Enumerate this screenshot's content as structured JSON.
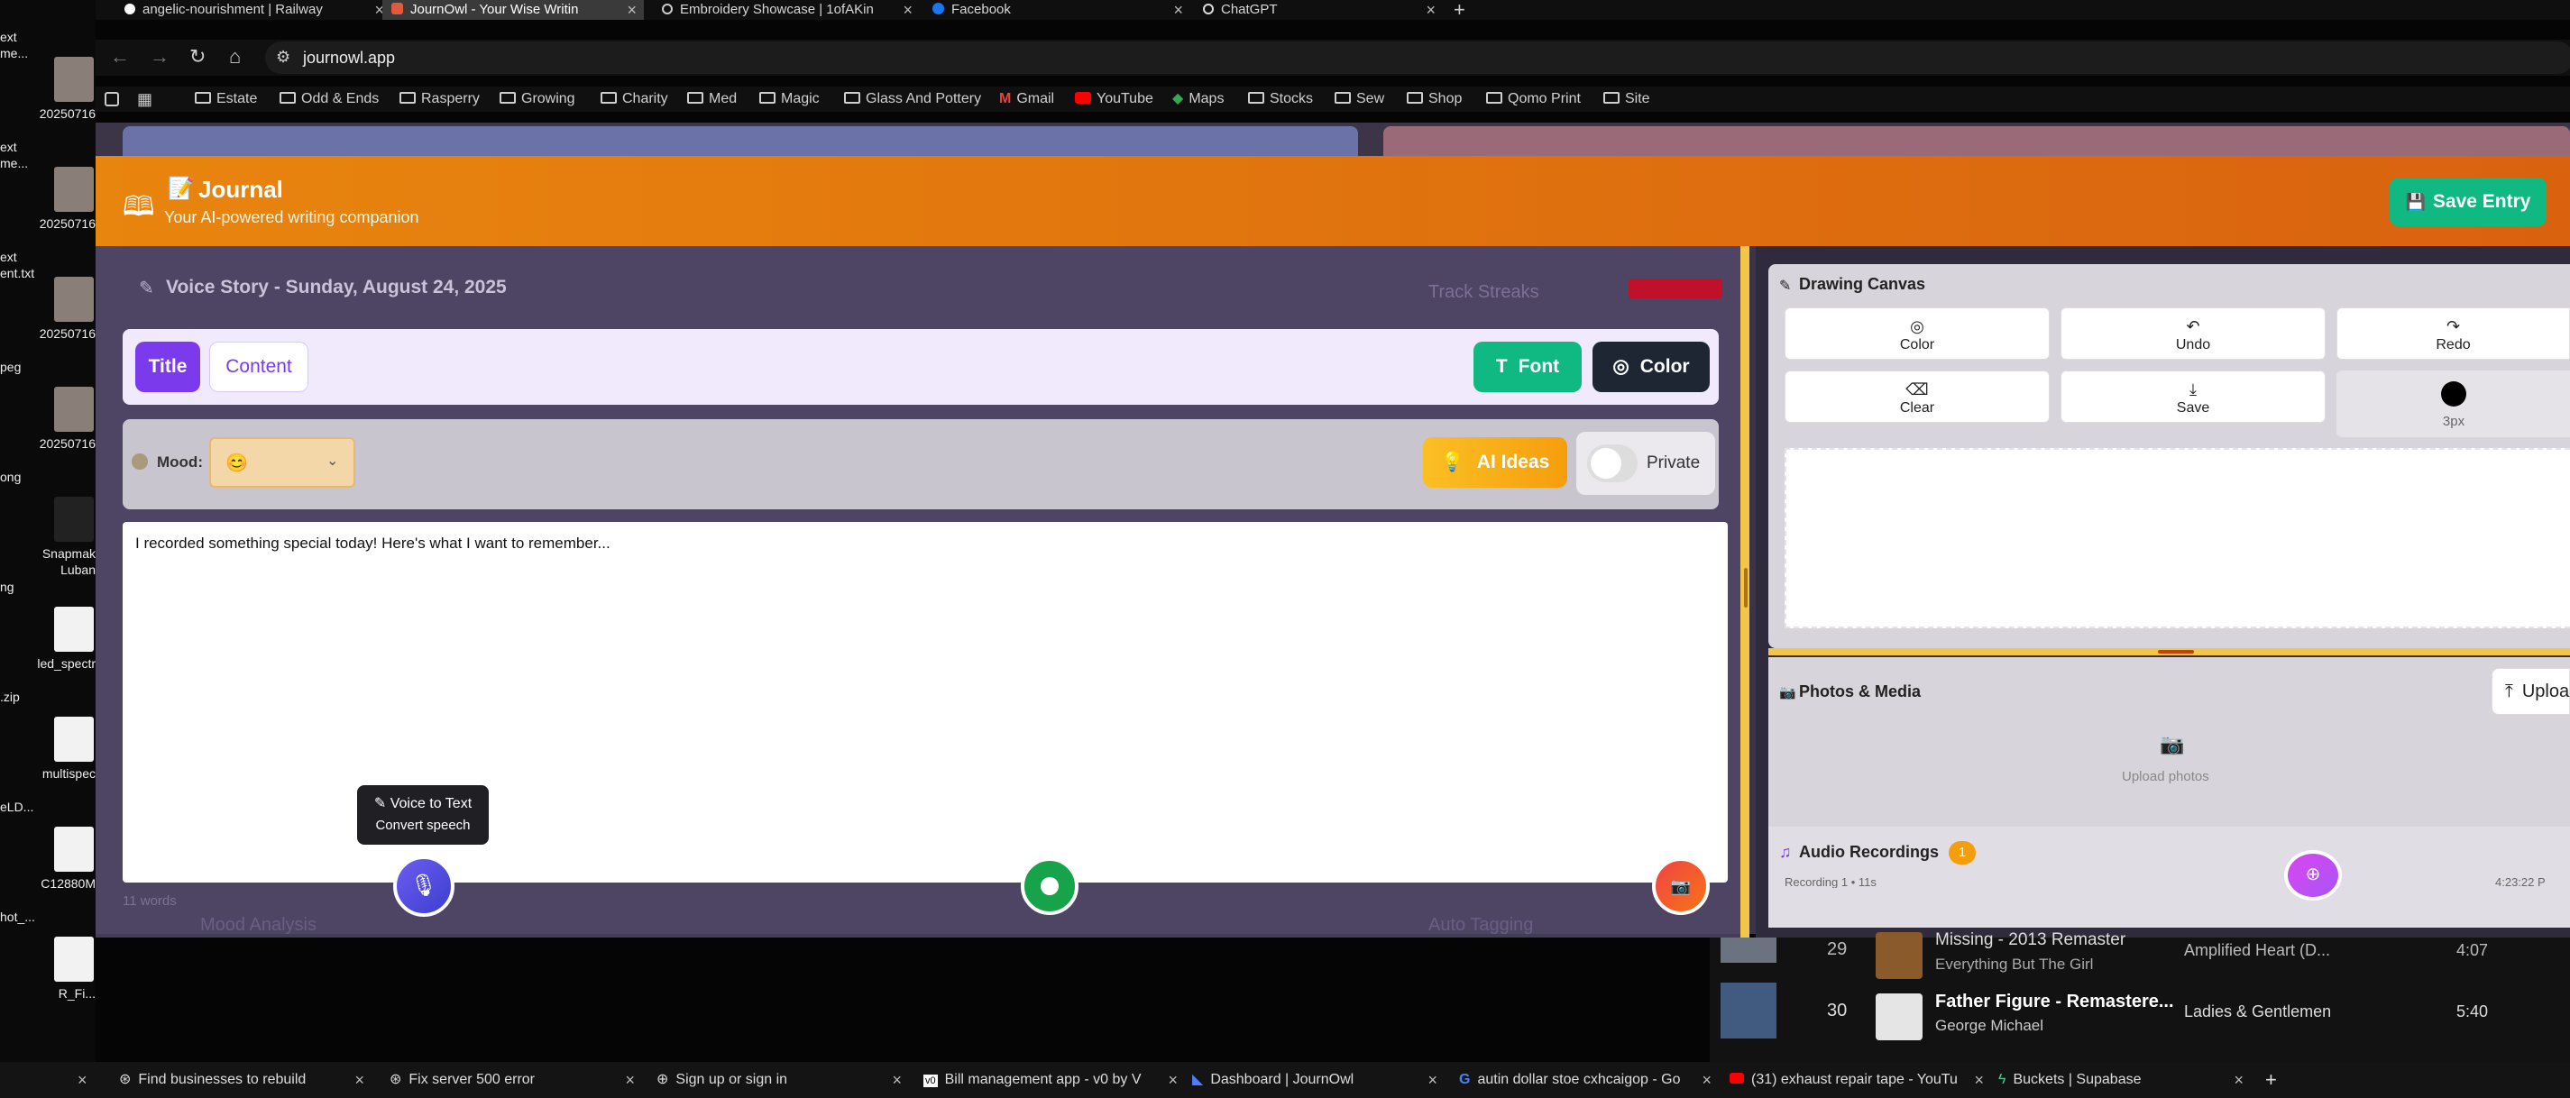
{
  "desktop": {
    "items": [
      {
        "label": "ext\nme...",
        "kind": "doc"
      },
      {
        "label": "20250716",
        "kind": "photo"
      },
      {
        "label": "ext\nme...",
        "kind": "doc"
      },
      {
        "label": "20250716",
        "kind": "photo"
      },
      {
        "label": "ext\nent.txt",
        "kind": "doc"
      },
      {
        "label": "20250716",
        "kind": "photo"
      },
      {
        "label": "peg",
        "kind": "photo"
      },
      {
        "label": "20250716",
        "kind": "photo"
      },
      {
        "label": "ong",
        "kind": "photo"
      },
      {
        "label": "Snapmak\nLuban",
        "kind": "app"
      },
      {
        "label": "ng",
        "kind": "photo"
      },
      {
        "label": "led_spectr",
        "kind": "doc"
      },
      {
        "label": ".zip",
        "kind": "zip"
      },
      {
        "label": "multispec",
        "kind": "doc"
      },
      {
        "label": "eLD...",
        "kind": "doc"
      },
      {
        "label": "C12880M",
        "kind": "doc"
      },
      {
        "label": "hot_...",
        "kind": "doc"
      },
      {
        "label": "R_Fi...",
        "kind": "doc"
      }
    ]
  },
  "browser": {
    "tabs": [
      {
        "label": "angelic-nourishment | Railway",
        "active": false,
        "icon": "railway-icon"
      },
      {
        "label": "JournOwl - Your Wise Writin",
        "active": true,
        "icon": "journowl-icon"
      },
      {
        "label": "Embroidery Showcase | 1ofAKin",
        "active": false,
        "icon": "globe-icon"
      },
      {
        "label": "Facebook",
        "active": false,
        "icon": "facebook-icon"
      },
      {
        "label": "ChatGPT",
        "active": false,
        "icon": "chatgpt-icon"
      }
    ],
    "new_tab": "+",
    "url": "journowl.app",
    "bookmarks": [
      {
        "label": "Estate",
        "icon": "folder-icon"
      },
      {
        "label": "Odd & Ends",
        "icon": "folder-icon"
      },
      {
        "label": "Rasperry",
        "icon": "folder-icon"
      },
      {
        "label": "Growing",
        "icon": "folder-icon"
      },
      {
        "label": "Charity",
        "icon": "folder-icon"
      },
      {
        "label": "Med",
        "icon": "folder-icon"
      },
      {
        "label": "Magic",
        "icon": "folder-icon"
      },
      {
        "label": "Glass And Pottery",
        "icon": "folder-icon"
      },
      {
        "label": "Gmail",
        "icon": "gmail-icon"
      },
      {
        "label": "YouTube",
        "icon": "youtube-icon"
      },
      {
        "label": "Maps",
        "icon": "maps-icon"
      },
      {
        "label": "Stocks",
        "icon": "folder-icon"
      },
      {
        "label": "Sew",
        "icon": "folder-icon"
      },
      {
        "label": "Shop",
        "icon": "folder-icon"
      },
      {
        "label": "Qomo Print",
        "icon": "folder-icon"
      },
      {
        "label": "Site",
        "icon": "folder-icon"
      }
    ]
  },
  "journal": {
    "title": "Journal",
    "subtitle": "Your AI-powered writing companion",
    "save_entry": "Save Entry",
    "story_title": "Voice Story - Sunday, August 24, 2025",
    "title_tab": "Title",
    "content_tab": "Content",
    "font_btn": "Font",
    "color_btn": "Color",
    "mood_label": "Mood:",
    "mood_value": "😊",
    "ai_ideas": "AI Ideas",
    "private_label": "Private",
    "entry_text": "I recorded something special today! Here's what I want to remember...",
    "word_count": "11 words",
    "voice_tooltip_title": "Voice to Text",
    "voice_tooltip_sub": "Convert speech",
    "background": {
      "track_streaks": "Track Streaks",
      "mood_analysis": "Mood Analysis",
      "auto_tagging": "Auto Tagging"
    },
    "accent_orange": "#e07a10",
    "accent_purple": "#7c3aed",
    "accent_green": "#10b981"
  },
  "drawing": {
    "title": "Drawing Canvas",
    "tools": [
      {
        "label": "Color",
        "icon": "palette-icon"
      },
      {
        "label": "Undo",
        "icon": "undo-icon"
      },
      {
        "label": "Redo",
        "icon": "redo-icon"
      },
      {
        "label": "Clear",
        "icon": "eraser-icon"
      },
      {
        "label": "Save",
        "icon": "download-icon"
      },
      {
        "label": "3px",
        "icon": "brush-size-icon"
      }
    ]
  },
  "media": {
    "title": "Photos & Media",
    "upload_btn": "Uploa",
    "upload_photos": "Upload photos",
    "audio_title": "Audio Recordings",
    "audio_count": "1",
    "recording_line": "Recording 1 • 11s",
    "recording_time": "4:23:22 P"
  },
  "music": {
    "rows": [
      {
        "num": "29",
        "title": "Missing - 2013 Remaster",
        "artist": "Everything But The Girl",
        "album": "Amplified Heart (D...",
        "duration": "4:07"
      },
      {
        "num": "30",
        "title": "Father Figure - Remastere...",
        "artist": "George Michael",
        "album": "Ladies & Gentlemen",
        "duration": "5:40"
      }
    ]
  },
  "taskbar": {
    "tabs": [
      {
        "label": "Find businesses to rebuild",
        "icon": "chatgpt-icon"
      },
      {
        "label": "Fix server 500 error",
        "icon": "chatgpt-icon"
      },
      {
        "label": "Sign up or sign in",
        "icon": "globe-icon"
      },
      {
        "label": "Bill management app - v0 by V",
        "icon": "v0-icon"
      },
      {
        "label": "Dashboard | JournOwl",
        "icon": "journowl-icon"
      },
      {
        "label": "autin dollar stoe cxhcaigop - Go",
        "icon": "google-icon"
      },
      {
        "label": "(31) exhaust repair tape - YouTu",
        "icon": "youtube-icon"
      },
      {
        "label": "Buckets | Supabase",
        "icon": "supabase-icon"
      }
    ],
    "new_tab": "+"
  }
}
